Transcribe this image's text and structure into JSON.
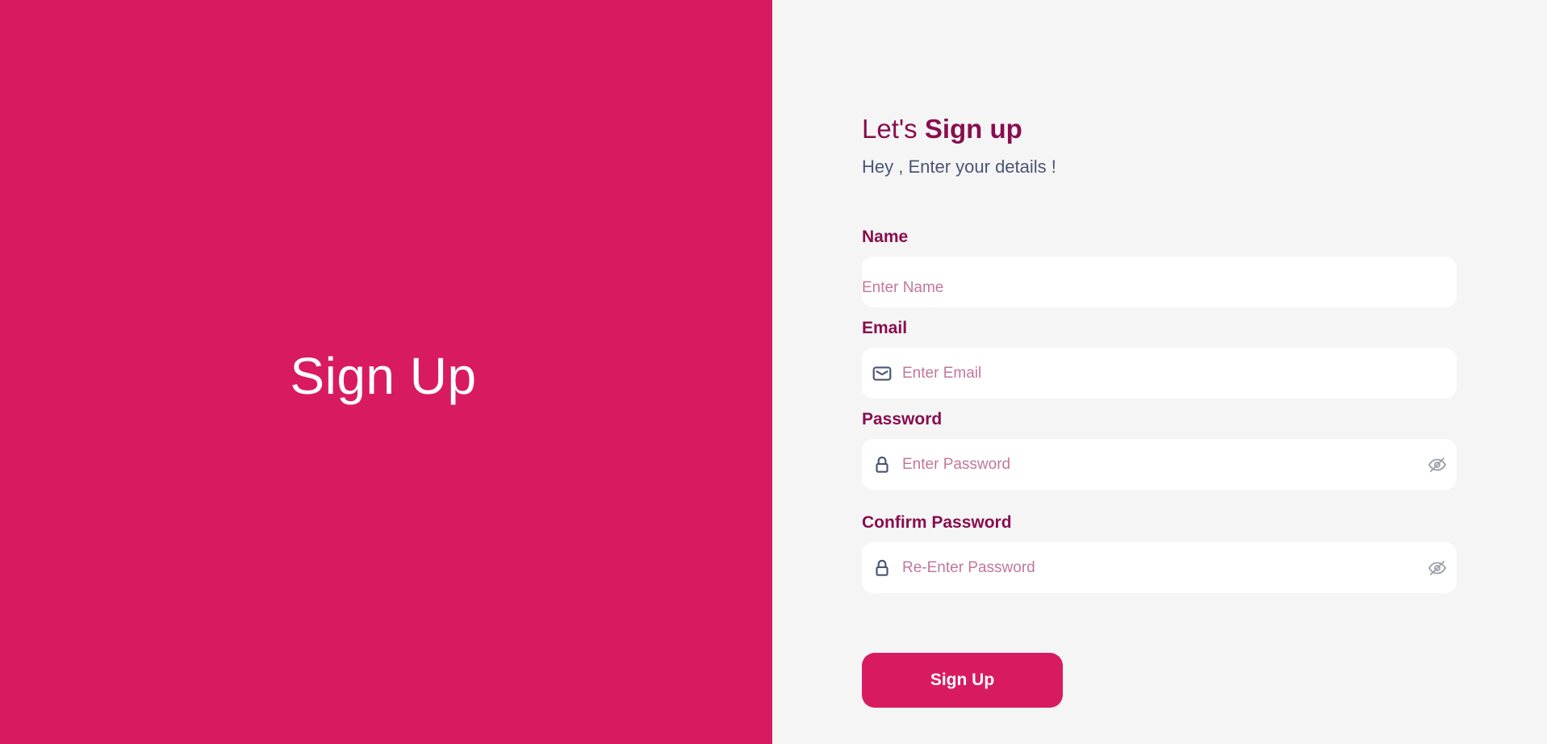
{
  "brand_panel": {
    "title": "Sign Up"
  },
  "form": {
    "heading_light": "Let's ",
    "heading_bold": "Sign up",
    "subheading": "Hey , Enter your details !",
    "fields": {
      "name": {
        "label": "Name",
        "placeholder": "Enter Name",
        "value": ""
      },
      "email": {
        "label": "Email",
        "placeholder": "Enter Email",
        "value": "",
        "icon": "mail-icon"
      },
      "password": {
        "label": "Password",
        "placeholder": "Enter Password",
        "value": "",
        "icon": "lock-icon",
        "toggle_icon": "eye-off-icon"
      },
      "confirm_password": {
        "label": "Confirm Password",
        "placeholder": "Re-Enter Password",
        "value": "",
        "icon": "lock-icon",
        "toggle_icon": "eye-off-icon"
      }
    },
    "submit_label": "Sign Up"
  },
  "colors": {
    "accent": "#d81b60",
    "heading": "#880e4f",
    "subtext": "#4a5575",
    "placeholder": "#c2779c",
    "panel_background": "#f5f5f5"
  }
}
